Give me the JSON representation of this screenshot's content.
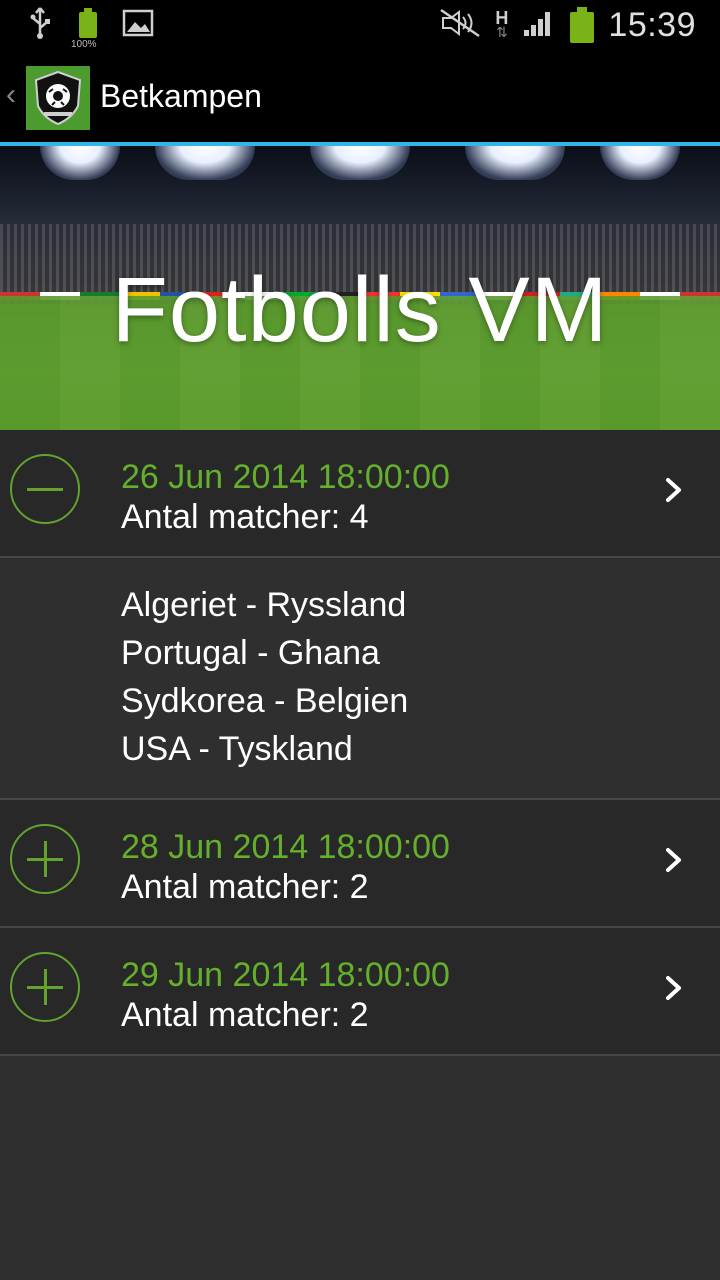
{
  "status_bar": {
    "time": "15:39",
    "battery_small_label": "100%",
    "network_label": "H",
    "icons": [
      "usb-icon",
      "battery-icon",
      "image-icon",
      "mute-icon",
      "h-network-icon",
      "signal-icon",
      "battery-icon"
    ]
  },
  "action_bar": {
    "title": "Betkampen",
    "back_glyph": "‹"
  },
  "banner": {
    "title": "Fotbolls VM"
  },
  "groups": [
    {
      "date": "26 Jun 2014 18:00:00",
      "count_label": "Antal matcher: 4",
      "expanded": true,
      "toggle_icon": "minus-icon",
      "matches": [
        "Algeriet - Ryssland",
        "Portugal - Ghana",
        "Sydkorea - Belgien",
        "USA - Tyskland"
      ]
    },
    {
      "date": "28 Jun 2014 18:00:00",
      "count_label": "Antal matcher: 2",
      "expanded": false,
      "toggle_icon": "plus-icon"
    },
    {
      "date": "29 Jun 2014 18:00:00",
      "count_label": "Antal matcher: 2",
      "expanded": false,
      "toggle_icon": "plus-icon"
    }
  ],
  "colors": {
    "accent_green": "#64b02c",
    "actionbar_underline": "#33b5e5",
    "row_bg": "#282828",
    "list_bg": "#2f2f2f"
  }
}
